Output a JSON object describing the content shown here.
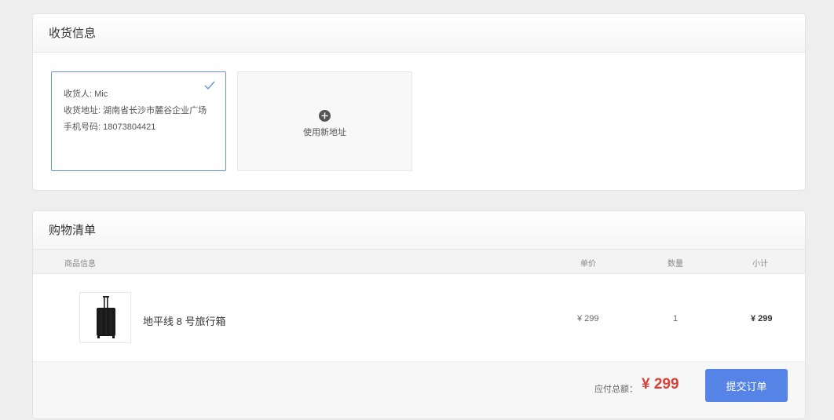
{
  "address_section": {
    "title": "收货信息",
    "selected_address": {
      "recipient": "收货人: Mic",
      "address": "收货地址: 湖南省长沙市麓谷企业广场",
      "phone": "手机号码: 18073804421"
    },
    "new_address_label": "使用新地址",
    "accent_color": "#678ee7"
  },
  "cart_section": {
    "title": "购物清单",
    "columns": {
      "info": "商品信息",
      "price": "单价",
      "quantity": "数量",
      "subtotal": "小计"
    },
    "items": [
      {
        "name": "地平线 8 号旅行箱",
        "price": "¥ 299",
        "quantity": "1",
        "subtotal": "¥ 299",
        "image_icon": "suitcase-icon"
      }
    ],
    "total_label": "应付总额：",
    "total_value": "¥ 299",
    "submit_label": "提交订单",
    "total_color": "#d9413b",
    "button_color": "#5684e6"
  }
}
